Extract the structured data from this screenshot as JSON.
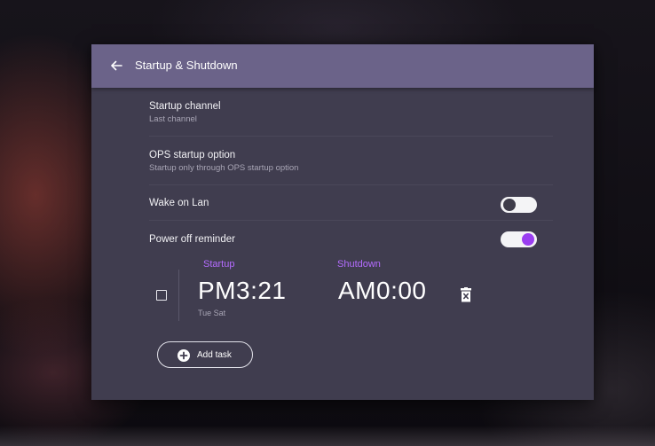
{
  "header": {
    "title": "Startup & Shutdown",
    "back_icon": "arrow-left-icon"
  },
  "settings": {
    "startup_channel": {
      "title": "Startup channel",
      "subtitle": "Last channel"
    },
    "ops_startup": {
      "title": "OPS startup option",
      "subtitle": "Startup only through OPS startup option"
    },
    "wake_on_lan": {
      "title": "Wake on Lan",
      "enabled": false
    },
    "power_off_reminder": {
      "title": "Power off reminder",
      "enabled": true
    }
  },
  "schedule": {
    "startup_label": "Startup",
    "shutdown_label": "Shutdown",
    "task": {
      "checked": false,
      "startup_time": "PM3:21",
      "shutdown_time": "AM0:00",
      "days": "Tue Sat"
    },
    "add_task_label": "Add task"
  },
  "colors": {
    "accent": "#9a3ef0",
    "label_accent": "#b46cff",
    "header": "#6b6389",
    "panel": "#403d4f"
  }
}
